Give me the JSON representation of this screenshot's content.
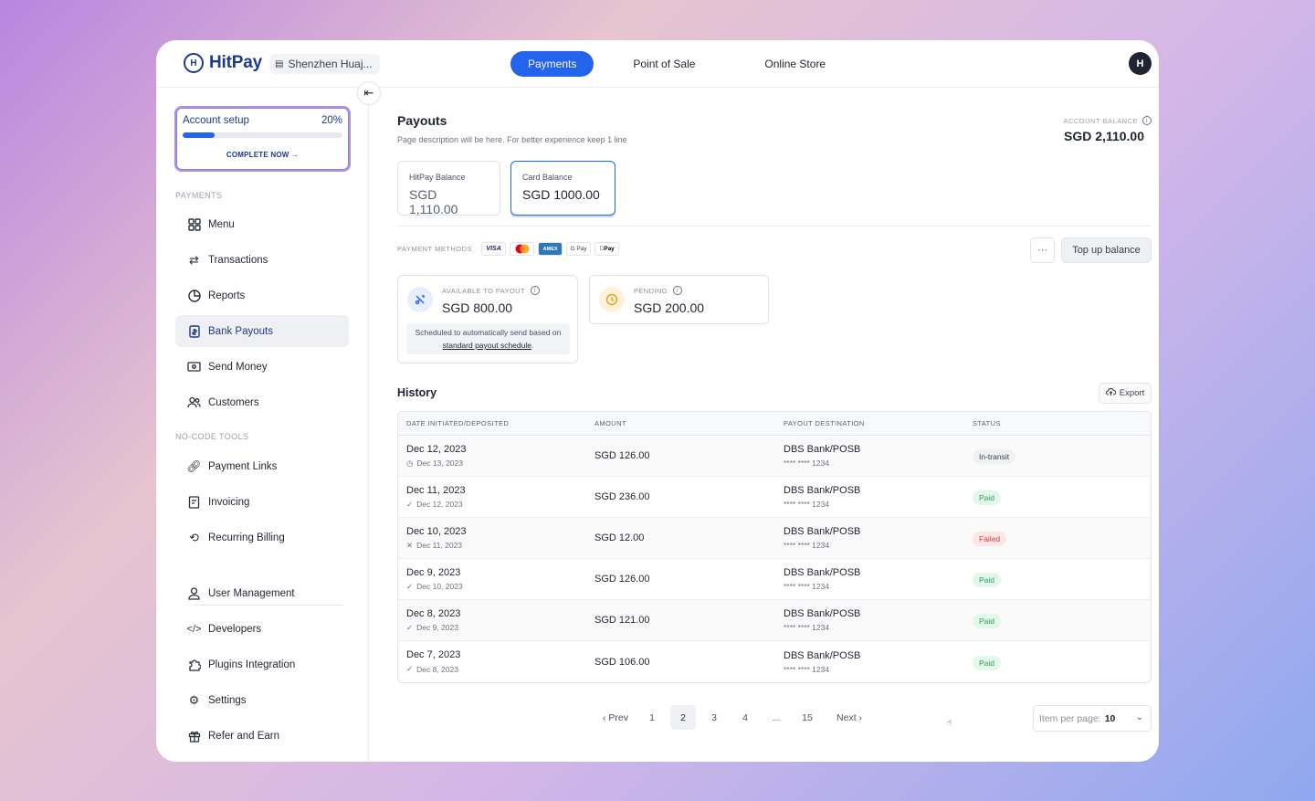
{
  "brand": {
    "name": "HitPay",
    "mark": "H"
  },
  "shop": {
    "name": "Shenzhen Huaj..."
  },
  "topnav": [
    {
      "label": "Payments",
      "active": true
    },
    {
      "label": "Point of Sale",
      "active": false
    },
    {
      "label": "Online Store",
      "active": false
    }
  ],
  "user": {
    "initial": "H"
  },
  "setup": {
    "title": "Account setup",
    "percent": "20%",
    "progress": 0.2,
    "cta": "COMPLETE NOW →"
  },
  "sidebar": {
    "payments_label": "PAYMENTS",
    "payments": [
      {
        "label": "Menu",
        "icon": "grid-icon"
      },
      {
        "label": "Transactions",
        "icon": "arrows-icon"
      },
      {
        "label": "Reports",
        "icon": "chart-icon"
      },
      {
        "label": "Bank Payouts",
        "icon": "bank-icon",
        "active": true
      },
      {
        "label": "Send Money",
        "icon": "money-icon"
      },
      {
        "label": "Customers",
        "icon": "users-icon"
      }
    ],
    "nocode_label": "NO-CODE TOOLS",
    "nocode": [
      {
        "label": "Payment Links",
        "icon": "link-icon"
      },
      {
        "label": "Invoicing",
        "icon": "invoice-icon"
      },
      {
        "label": "Recurring Billing",
        "icon": "repeat-icon"
      }
    ],
    "other": [
      {
        "label": "User Management",
        "icon": "user-icon"
      },
      {
        "label": "Developers",
        "icon": "code-icon"
      },
      {
        "label": "Plugins Integration",
        "icon": "puzzle-icon"
      },
      {
        "label": "Settings",
        "icon": "gear-icon"
      },
      {
        "label": "Refer and Earn",
        "icon": "gift-icon"
      }
    ]
  },
  "page": {
    "title": "Payouts",
    "description": "Page description will be here. For better experience keep 1 line",
    "account_balance_label": "ACCOUNT BALANCE",
    "account_balance": "SGD 2,110.00"
  },
  "balances": [
    {
      "label": "HitPay Balance",
      "value": "SGD 1,110.00",
      "active": false
    },
    {
      "label": "Card Balance",
      "value": "SGD 1000.00",
      "active": true
    }
  ],
  "payment_methods": {
    "label": "PAYMENT METHODS",
    "items": [
      "VISA",
      "Mastercard",
      "AMEX",
      "G Pay",
      "Pay"
    ]
  },
  "actions": {
    "more": "···",
    "topup": "Top up balance"
  },
  "available": {
    "label": "AVAILABLE TO PAYOUT",
    "value": "SGD 800.00",
    "note_prefix": "Scheduled to automatically send based on",
    "note_link": "standard payout schedule",
    "note_suffix": "."
  },
  "pending": {
    "label": "PENDING",
    "value": "SGD 200.00"
  },
  "history": {
    "title": "History",
    "export": "Export",
    "columns": [
      "DATE INITIATED/DEPOSITED",
      "AMOUNT",
      "PAYOUT DESTINATION",
      "STATUS"
    ],
    "rows": [
      {
        "date": "Dec 12, 2023",
        "sub_icon": "clock",
        "sub": "Dec 13, 2023",
        "amount": "SGD 126.00",
        "bank": "DBS Bank/POSB",
        "acct": "**** **** 1234",
        "status": "In-transit",
        "kind": "transit"
      },
      {
        "date": "Dec 11, 2023",
        "sub_icon": "check",
        "sub": "Dec 12, 2023",
        "amount": "SGD 236.00",
        "bank": "DBS Bank/POSB",
        "acct": "**** **** 1234",
        "status": "Paid",
        "kind": "paid"
      },
      {
        "date": "Dec 10, 2023",
        "sub_icon": "cross",
        "sub": "Dec 11, 2023",
        "amount": "SGD 12.00",
        "bank": "DBS Bank/POSB",
        "acct": "**** **** 1234",
        "status": "Failed",
        "kind": "failed"
      },
      {
        "date": "Dec 9, 2023",
        "sub_icon": "check",
        "sub": "Dec 10, 2023",
        "amount": "SGD 126.00",
        "bank": "DBS Bank/POSB",
        "acct": "**** **** 1234",
        "status": "Paid",
        "kind": "paid"
      },
      {
        "date": "Dec 8, 2023",
        "sub_icon": "check",
        "sub": "Dec 9, 2023",
        "amount": "SGD 121.00",
        "bank": "DBS Bank/POSB",
        "acct": "**** **** 1234",
        "status": "Paid",
        "kind": "paid"
      },
      {
        "date": "Dec 7, 2023",
        "sub_icon": "check",
        "sub": "Dec 8, 2023",
        "amount": "SGD 106.00",
        "bank": "DBS Bank/POSB",
        "acct": "**** **** 1234",
        "status": "Paid",
        "kind": "paid"
      }
    ]
  },
  "pagination": {
    "prev": "‹ Prev",
    "pages": [
      "1",
      "2",
      "3",
      "4",
      "...",
      "15"
    ],
    "current": "2",
    "next": "Next ›",
    "per_page_label": "Item per page:",
    "per_page": "10"
  }
}
